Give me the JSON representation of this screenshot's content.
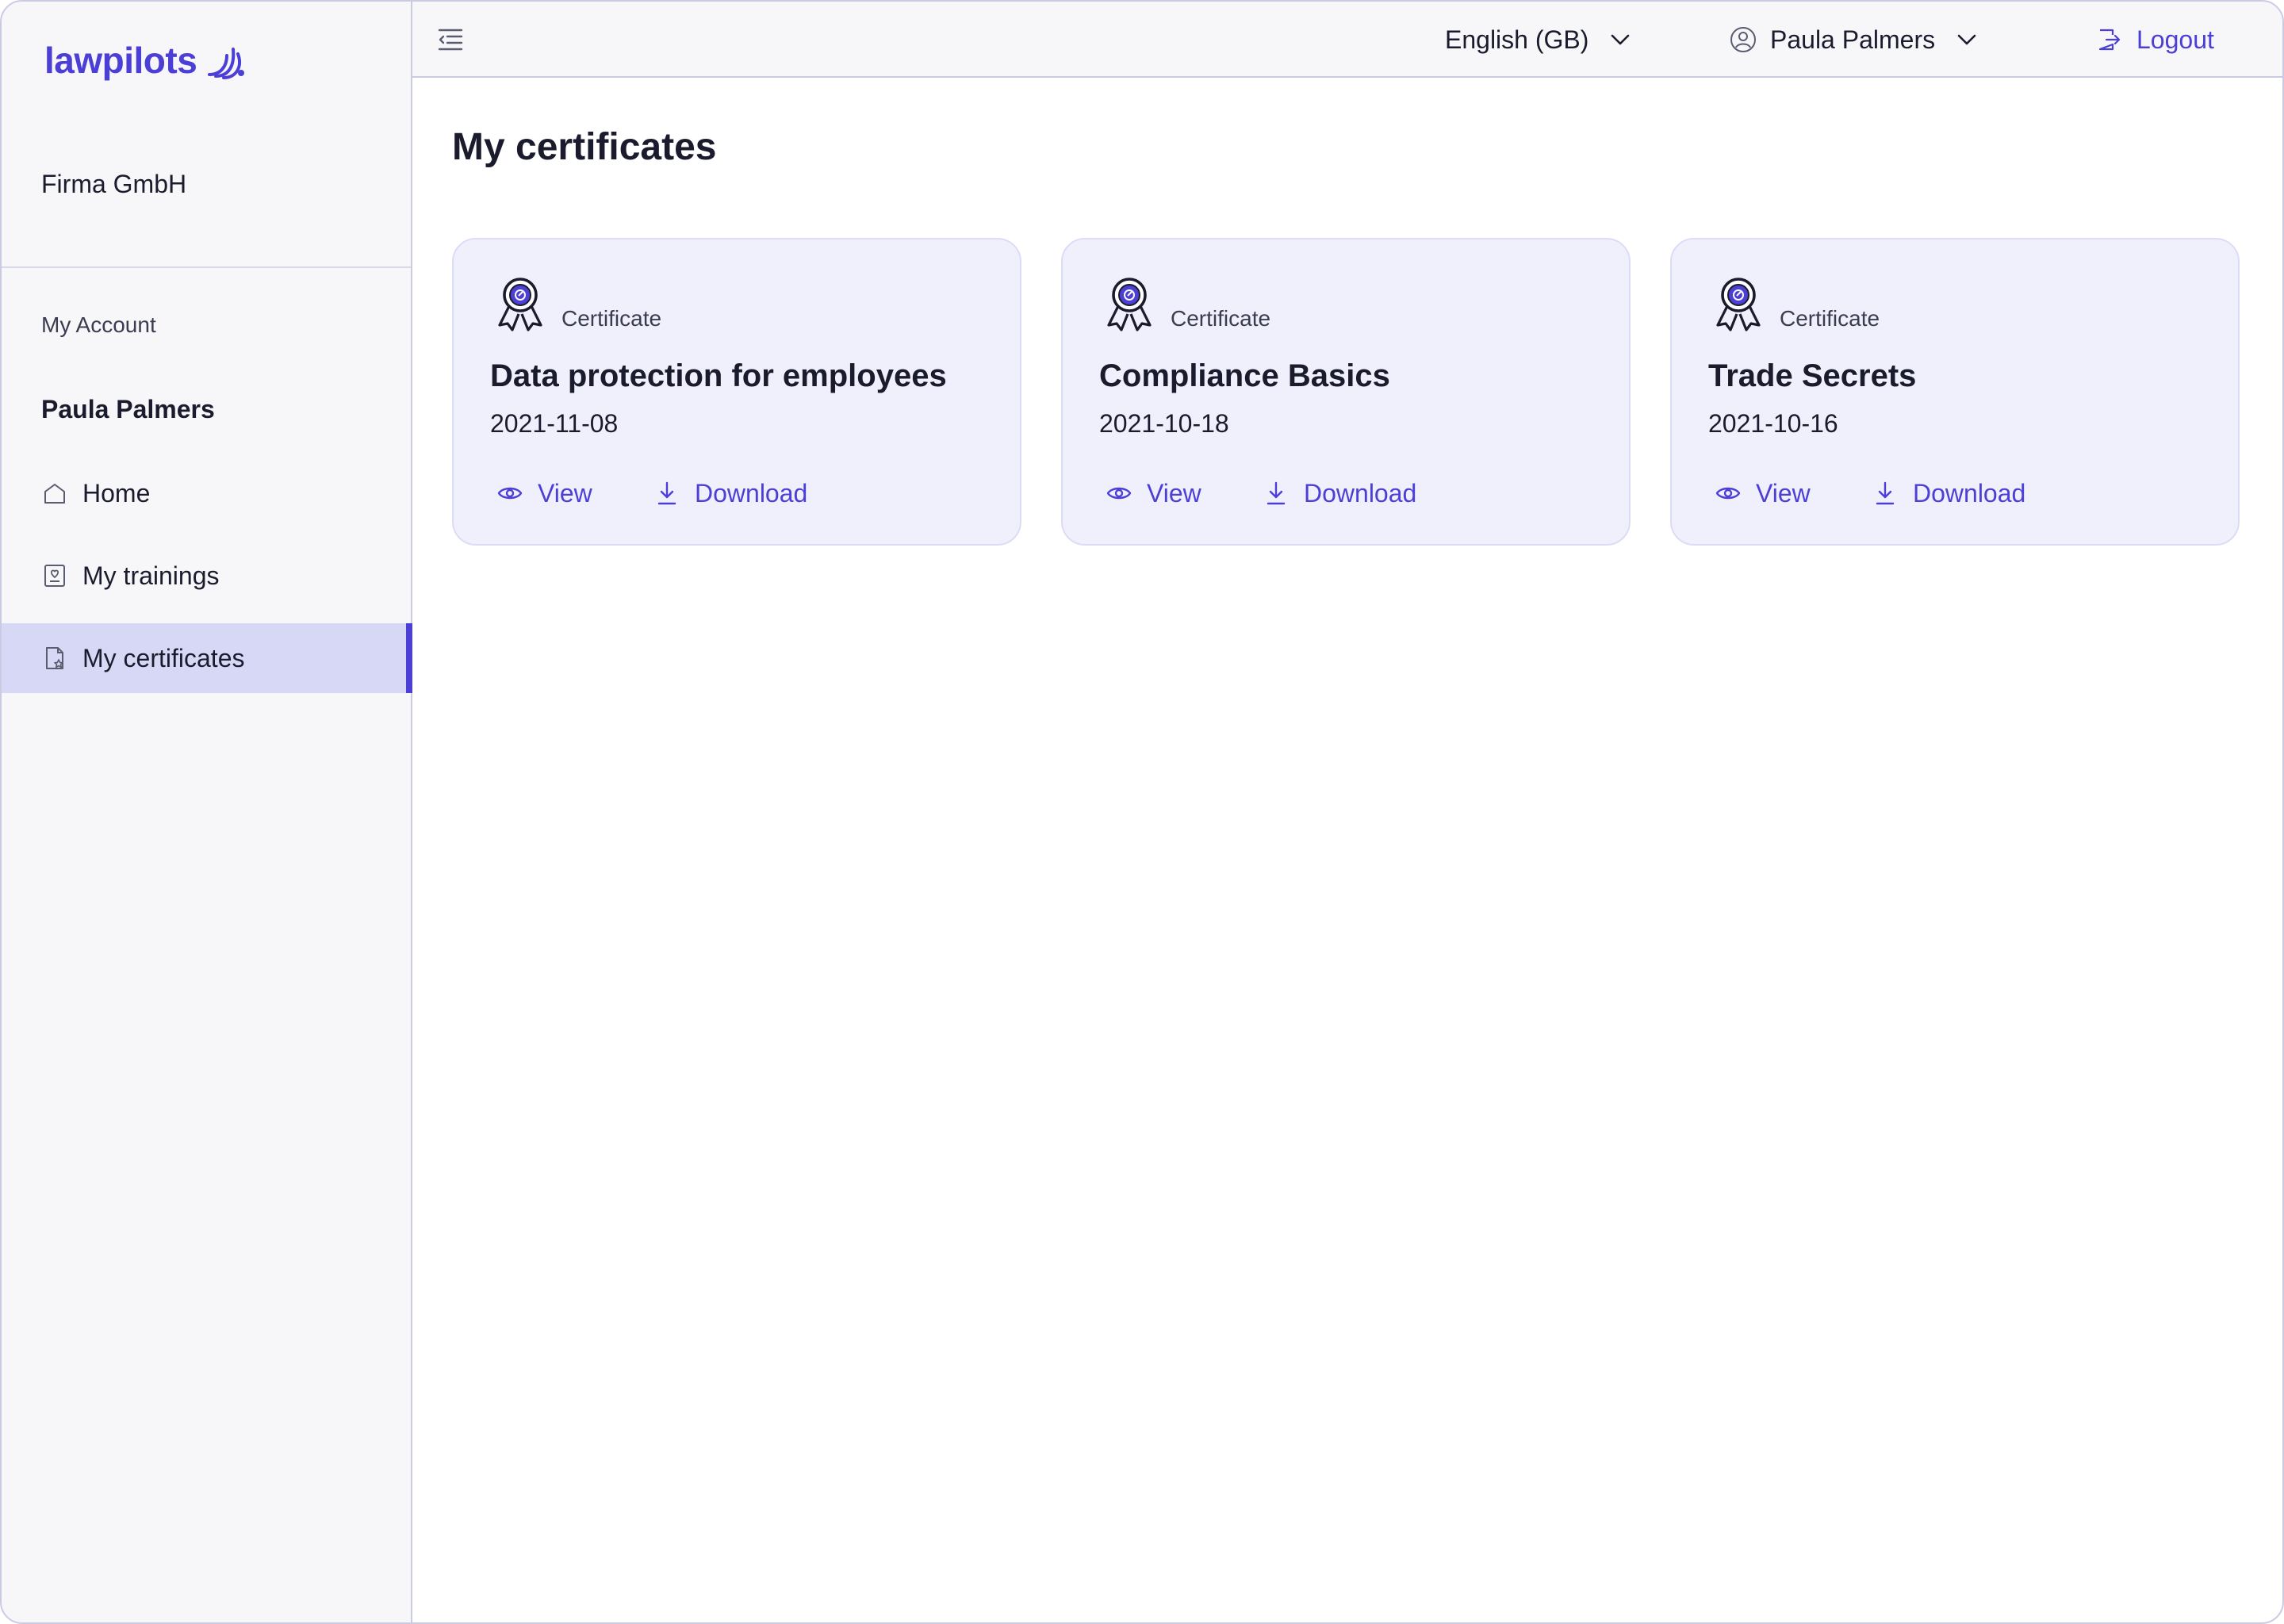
{
  "brand": {
    "name": "lawpilots",
    "accent": "#4b3fd6"
  },
  "sidebar": {
    "organization": "Firma GmbH",
    "section_label": "My Account",
    "user_name": "Paula Palmers",
    "items": [
      {
        "label": "Home",
        "icon": "home-icon"
      },
      {
        "label": "My trainings",
        "icon": "trainings-icon"
      },
      {
        "label": "My certificates",
        "icon": "certificate-doc-icon",
        "active": true
      }
    ]
  },
  "topbar": {
    "language": "English (GB)",
    "user": "Paula Palmers",
    "logout_label": "Logout"
  },
  "main": {
    "title": "My certificates",
    "cards": [
      {
        "label": "Certificate",
        "title": "Data protection for employees",
        "date": "2021-11-08",
        "view_label": "View",
        "download_label": "Download"
      },
      {
        "label": "Certificate",
        "title": "Compliance Basics",
        "date": "2021-10-18",
        "view_label": "View",
        "download_label": "Download"
      },
      {
        "label": "Certificate",
        "title": "Trade Secrets",
        "date": "2021-10-16",
        "view_label": "View",
        "download_label": "Download"
      }
    ]
  }
}
